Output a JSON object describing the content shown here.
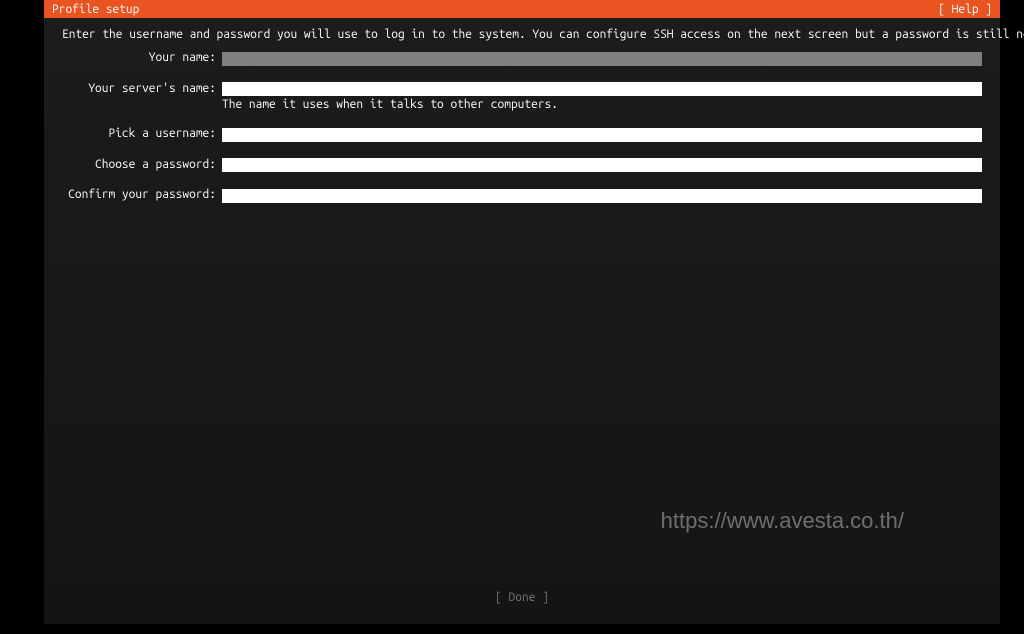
{
  "header": {
    "title": "Profile setup",
    "help_label": "[ Help ]"
  },
  "instructions": "Enter the username and password you will use to log in to the system. You can configure SSH access on the next screen but a password is still needed for sudo.",
  "form": {
    "your_name": {
      "label": "Your name:",
      "value": ""
    },
    "server_name": {
      "label": "Your server's name:",
      "value": "",
      "hint": "The name it uses when it talks to other computers."
    },
    "username": {
      "label": "Pick a username:",
      "value": ""
    },
    "password": {
      "label": "Choose a password:",
      "value": ""
    },
    "confirm_password": {
      "label": "Confirm your password:",
      "value": ""
    }
  },
  "footer": {
    "done_label": "[  Done    ]"
  },
  "watermark": "https://www.avesta.co.th/"
}
